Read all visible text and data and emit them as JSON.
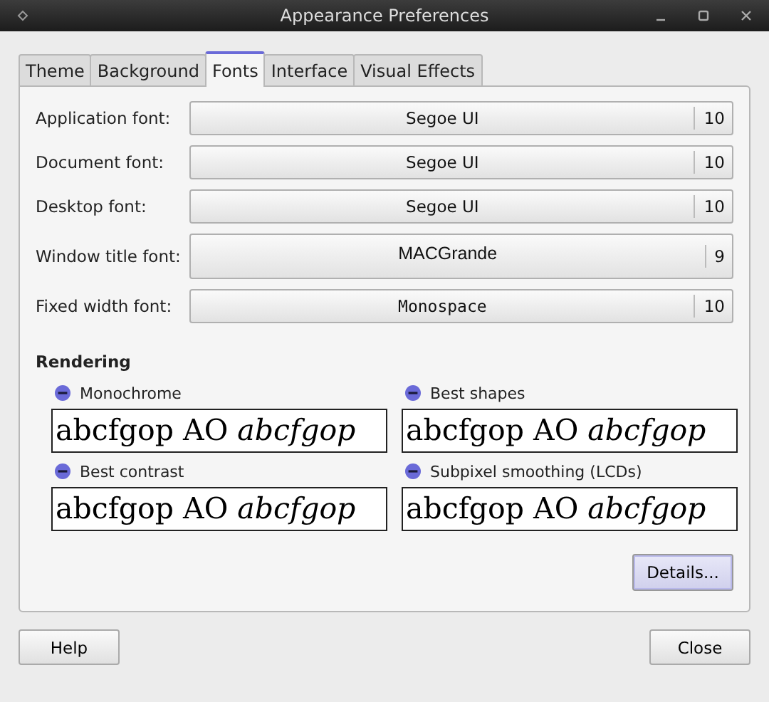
{
  "window": {
    "title": "Appearance Preferences"
  },
  "tabs": [
    {
      "label": "Theme",
      "selected": false
    },
    {
      "label": "Background",
      "selected": false
    },
    {
      "label": "Fonts",
      "selected": true
    },
    {
      "label": "Interface",
      "selected": false
    },
    {
      "label": "Visual Effects",
      "selected": false
    }
  ],
  "fonts": [
    {
      "label": "Application font:",
      "font": "Segoe UI",
      "size": "10",
      "kind": "sans"
    },
    {
      "label": "Document font:",
      "font": "Segoe UI",
      "size": "10",
      "kind": "sans"
    },
    {
      "label": "Desktop font:",
      "font": "Segoe UI",
      "size": "10",
      "kind": "sans"
    },
    {
      "label": "Window title font:",
      "font": "MACGrande",
      "size": "9",
      "kind": "display"
    },
    {
      "label": "Fixed width font:",
      "font": "Monospace",
      "size": "10",
      "kind": "mono"
    }
  ],
  "rendering": {
    "heading": "Rendering",
    "options": [
      {
        "label": "Monochrome",
        "selected": false,
        "sample": "abcfgop AO *abcfgop*"
      },
      {
        "label": "Best shapes",
        "selected": false,
        "sample": "abcfgop AO *abcfgop*"
      },
      {
        "label": "Best contrast",
        "selected": false,
        "sample": "abcfgop AO *abcfgop*"
      },
      {
        "label": "Subpixel smoothing (LCDs)",
        "selected": false,
        "sample": "abcfgop AO *abcfgop*"
      }
    ]
  },
  "details_button": "Details...",
  "buttons": [
    "Help",
    "Close"
  ]
}
